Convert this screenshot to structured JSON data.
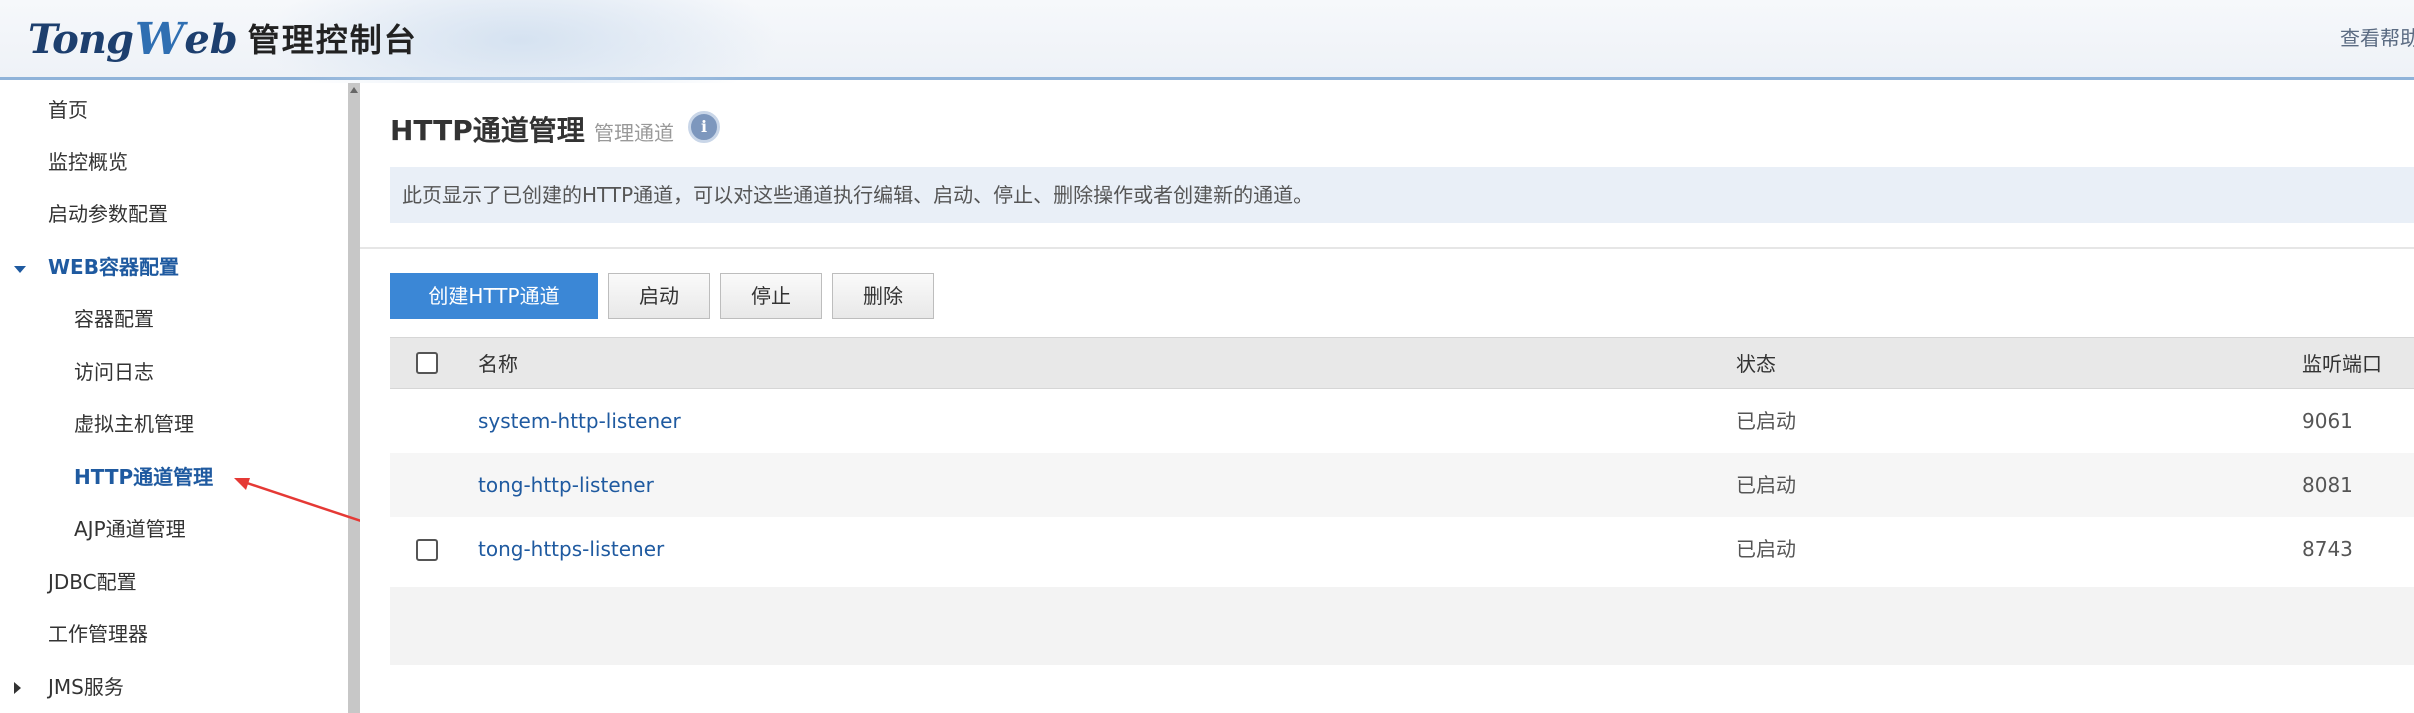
{
  "header": {
    "logo_part1": "Tong",
    "logo_part2": "W",
    "logo_part3": "eb",
    "logo_cn": "管理控制台",
    "help_label": "查看帮助"
  },
  "sidebar": {
    "items": [
      {
        "label": "首页"
      },
      {
        "label": "监控概览"
      },
      {
        "label": "启动参数配置"
      },
      {
        "label": "WEB容器配置"
      },
      {
        "label": "容器配置"
      },
      {
        "label": "访问日志"
      },
      {
        "label": "虚拟主机管理"
      },
      {
        "label": "HTTP通道管理"
      },
      {
        "label": "AJP通道管理"
      },
      {
        "label": "JDBC配置"
      },
      {
        "label": "工作管理器"
      },
      {
        "label": "JMS服务"
      }
    ]
  },
  "main": {
    "title": "HTTP通道管理",
    "subtitle": "管理通道",
    "info_icon": "i",
    "description": "此页显示了已创建的HTTP通道，可以对这些通道执行编辑、启动、停止、删除操作或者创建新的通道。",
    "buttons": {
      "create": "创建HTTP通道",
      "start": "启动",
      "stop": "停止",
      "delete": "删除"
    },
    "table": {
      "columns": [
        "名称",
        "状态",
        "监听端口"
      ],
      "rows": [
        {
          "name": "system-http-listener",
          "status": "已启动",
          "port": "9061"
        },
        {
          "name": "tong-http-listener",
          "status": "已启动",
          "port": "8081"
        },
        {
          "name": "tong-https-listener",
          "status": "已启动",
          "port": "8743"
        }
      ]
    }
  },
  "colors": {
    "accent": "#1f5aa0",
    "primary_button": "#3b87d6",
    "annotation_arrow": "#e53935"
  }
}
